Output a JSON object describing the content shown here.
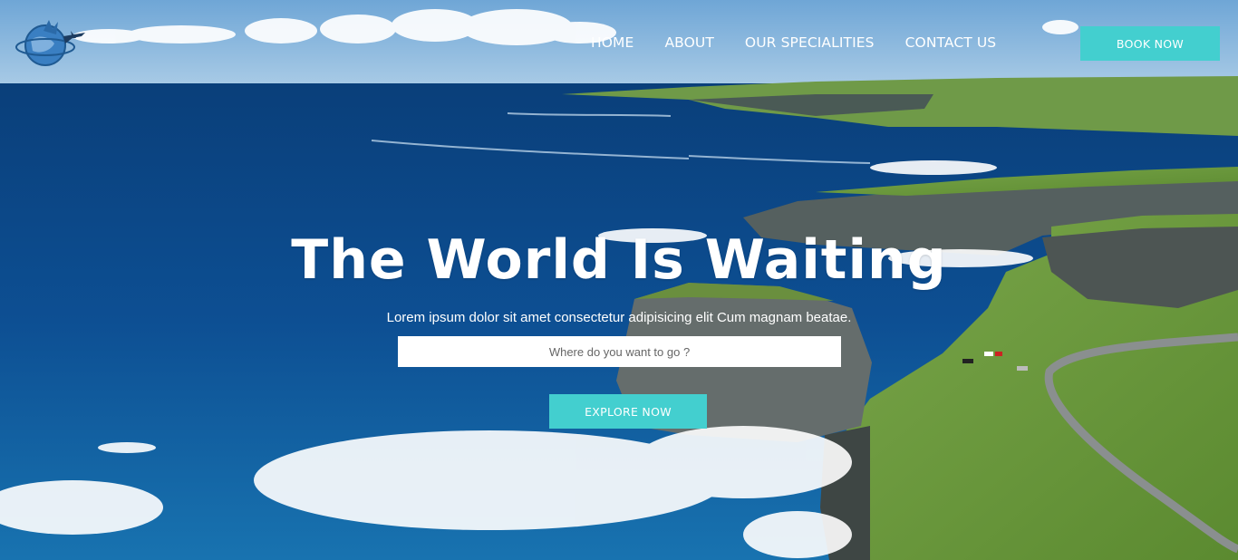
{
  "nav": {
    "logo_icon": "globe-airplane-logo-icon",
    "items": [
      {
        "label": "HOME"
      },
      {
        "label": "ABOUT"
      },
      {
        "label": "OUR SPECIALITIES"
      },
      {
        "label": "CONTACT US"
      }
    ],
    "book_label": "BOOK NOW"
  },
  "hero": {
    "title": "The World Is Waiting",
    "subtitle": "Lorem ipsum dolor sit amet consectetur adipisicing elit Cum magnam beatae.",
    "search_placeholder": "Where do you want to go ?",
    "search_value": "",
    "explore_label": "EXPLORE NOW"
  },
  "colors": {
    "accent": "#43cfcf",
    "sea": "#0b4a8a",
    "land": "#6e9a3a",
    "text": "#ffffff"
  }
}
